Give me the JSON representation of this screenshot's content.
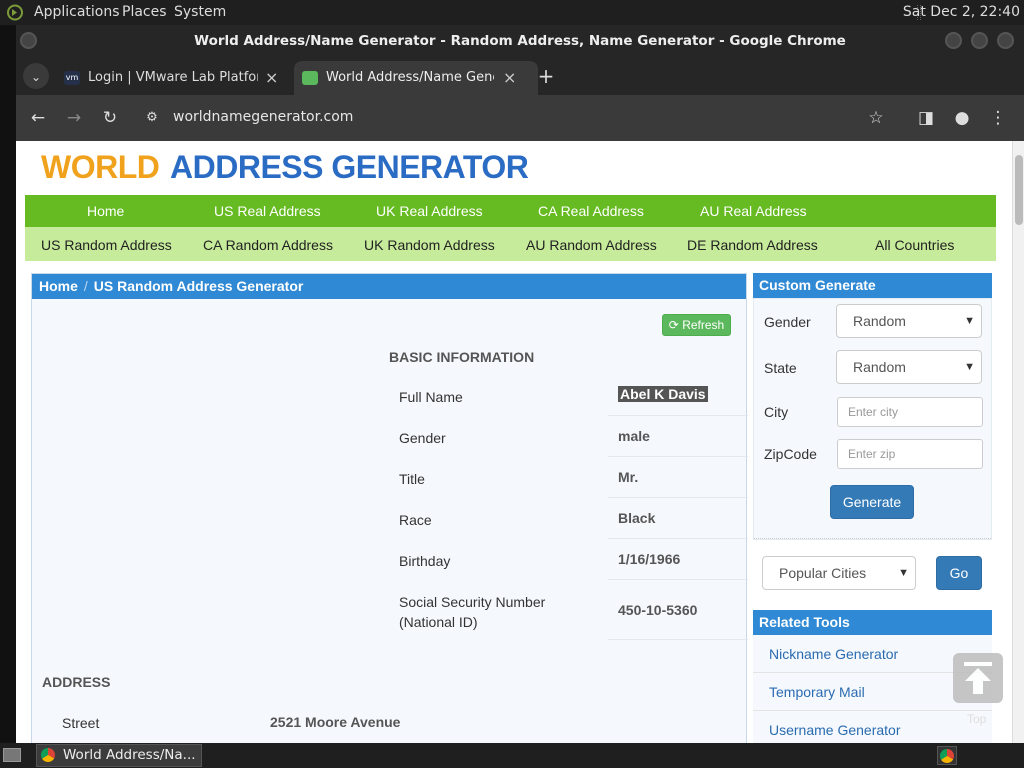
{
  "desktop": {
    "menus": [
      "Applications",
      "Places",
      "System"
    ],
    "clock": "Sat Dec 2, 22:40"
  },
  "window": {
    "title": "World Address/Name Generator - Random Address, Name Generator - Google Chrome"
  },
  "tabs": [
    {
      "title": "Login | VMware Lab Platform",
      "favicon": "vm-icon"
    },
    {
      "title": "World Address/Name Generator",
      "favicon": "map-pin-icon"
    }
  ],
  "toolbar": {
    "url": "worldnamegenerator.com"
  },
  "site": {
    "logo_word1": "WORLD",
    "logo_word2": "ADDRESS GENERATOR",
    "nav_primary": [
      "Home",
      "US Real Address",
      "UK Real Address",
      "CA Real Address",
      "AU Real Address"
    ],
    "nav_secondary": [
      "US Random Address",
      "CA Random Address",
      "UK Random Address",
      "AU Random Address",
      "DE Random Address",
      "All Countries"
    ]
  },
  "breadcrumb": {
    "home": "Home",
    "sep": "/",
    "current": "US Random Address Generator"
  },
  "main": {
    "refresh_label": "Refresh",
    "basic_title": "BASIC INFORMATION",
    "fields": [
      {
        "label": "Full Name",
        "value": "Abel K Davis"
      },
      {
        "label": "Gender",
        "value": "male"
      },
      {
        "label": "Title",
        "value": "Mr."
      },
      {
        "label": "Race",
        "value": "Black"
      },
      {
        "label": "Birthday",
        "value": "1/16/1966"
      },
      {
        "label": "Social Security Number (National ID)",
        "value": "450-10-5360"
      }
    ],
    "address_title": "ADDRESS",
    "street_label": "Street",
    "street_value": "2521 Moore Avenue"
  },
  "sidebar": {
    "custom_title": "Custom Generate",
    "gender_label": "Gender",
    "gender_value": "Random",
    "state_label": "State",
    "state_value": "Random",
    "city_label": "City",
    "city_placeholder": "Enter city",
    "zip_label": "ZipCode",
    "zip_placeholder": "Enter zip",
    "generate_label": "Generate",
    "popular_cities": "Popular Cities",
    "go_label": "Go",
    "related_title": "Related Tools",
    "tools": [
      "Nickname Generator",
      "Temporary Mail",
      "Username Generator"
    ],
    "top_label": "Top"
  },
  "taskbar": {
    "window_label": "World Address/Na..."
  },
  "colors": {
    "nav_primary": "#66bb22",
    "nav_secondary": "#c6eb9a",
    "header_blue": "#2f89d4",
    "logo_orange": "#f0a21c",
    "logo_blue": "#2a6bc4",
    "refresh_green": "#5cb85c",
    "button_blue": "#337ab7"
  }
}
